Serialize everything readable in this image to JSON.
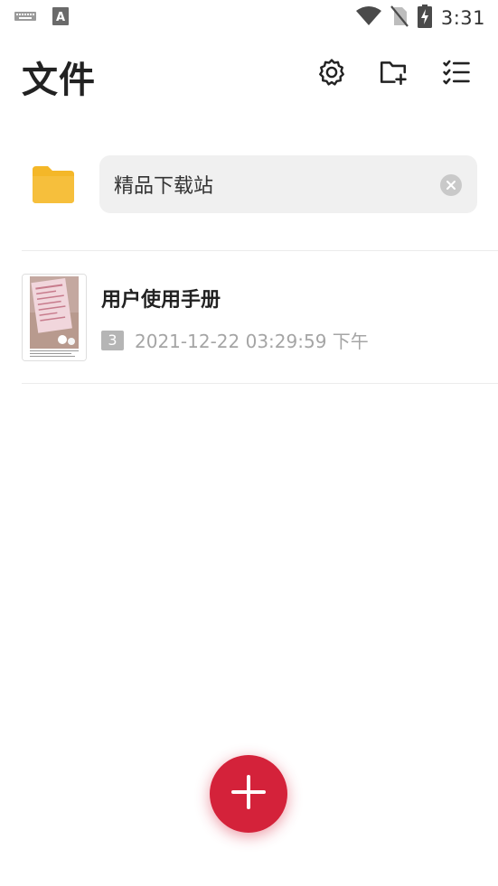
{
  "status_bar": {
    "time": "3:31",
    "icons": [
      "keyboard-icon",
      "a-icon",
      "wifi-icon",
      "no-sim-icon",
      "battery-charging-icon"
    ]
  },
  "header": {
    "title": "文件",
    "actions": [
      "settings-icon",
      "new-folder-icon",
      "checklist-icon"
    ]
  },
  "folder": {
    "icon": "folder-icon",
    "name": "精品下载站",
    "color": "#f4b728"
  },
  "documents": [
    {
      "title": "用户使用手册",
      "page_count": "3",
      "date": "2021-12-22 03:29:59 下午"
    }
  ],
  "fab": {
    "icon": "plus-icon",
    "color": "#d4223a"
  }
}
